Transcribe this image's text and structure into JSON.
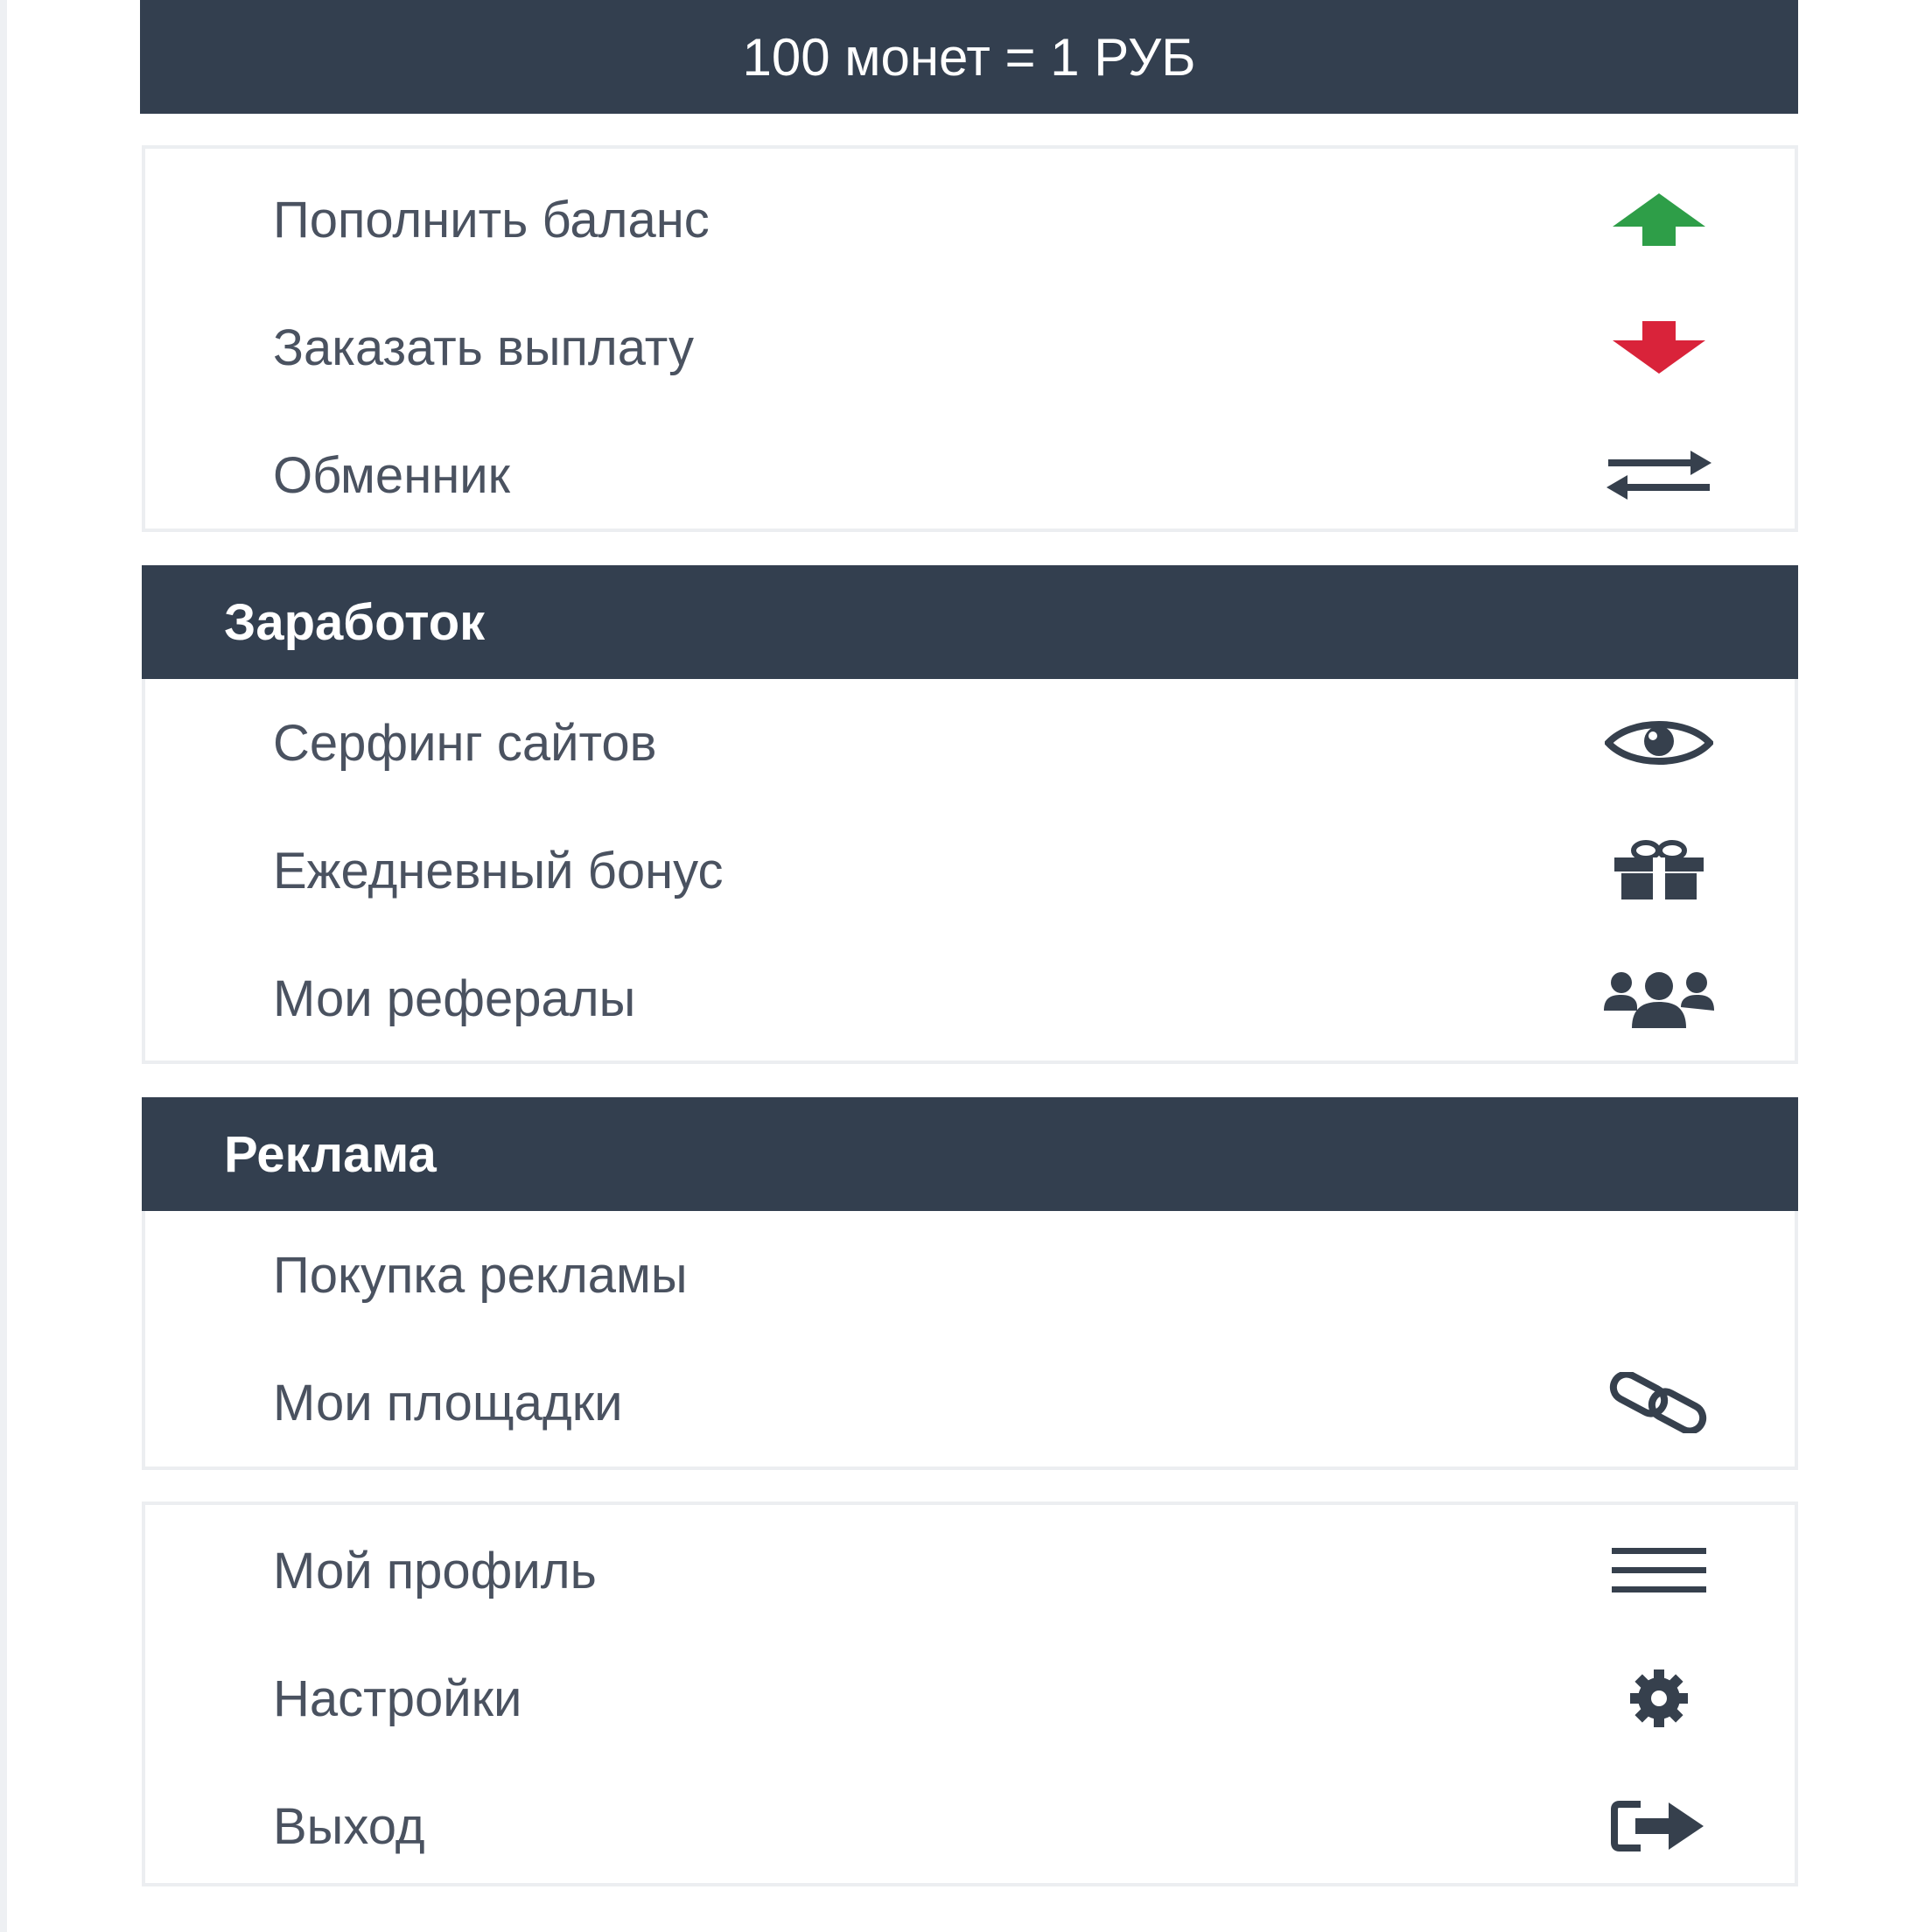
{
  "rate_bar": {
    "text": "100 монет = 1 РУБ"
  },
  "balance_panel": {
    "items": [
      {
        "label": "Пополнить баланс",
        "icon": "arrow-up-icon",
        "icon_color": "#2e9e48"
      },
      {
        "label": "Заказать выплату",
        "icon": "arrow-down-icon",
        "icon_color": "#d9233a"
      },
      {
        "label": "Обменник",
        "icon": "exchange-icon",
        "icon_color": "#36404d"
      }
    ]
  },
  "earnings_panel": {
    "title": "Заработок",
    "items": [
      {
        "label": "Серфинг сайтов",
        "icon": "eye-icon"
      },
      {
        "label": "Ежедневный бонус",
        "icon": "gift-icon"
      },
      {
        "label": "Мои рефералы",
        "icon": "users-icon"
      }
    ]
  },
  "ads_panel": {
    "title": "Реклама",
    "items": [
      {
        "label": "Покупка рекламы",
        "icon": ""
      },
      {
        "label": "Мои площадки",
        "icon": "link-icon"
      }
    ]
  },
  "account_panel": {
    "items": [
      {
        "label": "Мой профиль",
        "icon": "menu-bars-icon"
      },
      {
        "label": "Настройки",
        "icon": "gear-icon"
      },
      {
        "label": "Выход",
        "icon": "sign-out-icon"
      }
    ]
  },
  "colors": {
    "header_bg": "#333f4f",
    "text": "#4a5260",
    "icon_dark": "#36404d",
    "icon_green": "#2e9e48",
    "icon_red": "#d9233a"
  }
}
